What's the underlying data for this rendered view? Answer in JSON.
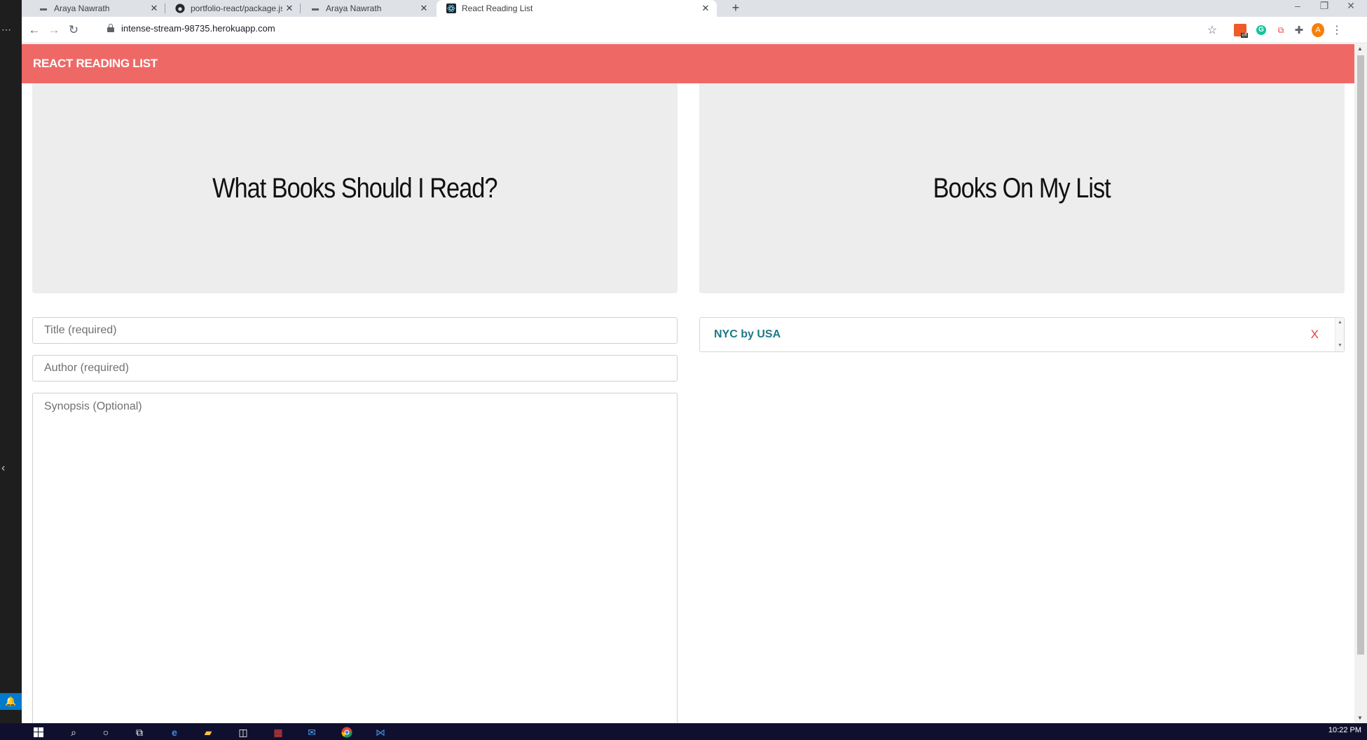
{
  "browser": {
    "tabs": [
      {
        "title": "Araya Nawrath",
        "icon": "site-icon"
      },
      {
        "title": "portfolio-react/package.json at m",
        "icon": "github-icon"
      },
      {
        "title": "Araya Nawrath",
        "icon": "site-icon"
      },
      {
        "title": "React Reading List",
        "icon": "react-icon"
      }
    ],
    "url": "intense-stream-98735.herokuapp.com",
    "profile_initial": "A",
    "extension_badge": "off"
  },
  "app": {
    "brand": "React Reading List",
    "left_heading": "What Books Should I Read?",
    "right_heading": "Books On My List",
    "form": {
      "title_placeholder": "Title (required)",
      "author_placeholder": "Author (required)",
      "synopsis_placeholder": "Synopsis (Optional)"
    },
    "books": [
      {
        "label": "NYC by USA",
        "delete_label": "X"
      }
    ]
  },
  "taskbar": {
    "clock": "10:22 PM"
  },
  "colors": {
    "navbar": "#ee6966",
    "jumbotron": "#ededed",
    "book_link": "#1c7a88",
    "delete": "#e8413f"
  }
}
